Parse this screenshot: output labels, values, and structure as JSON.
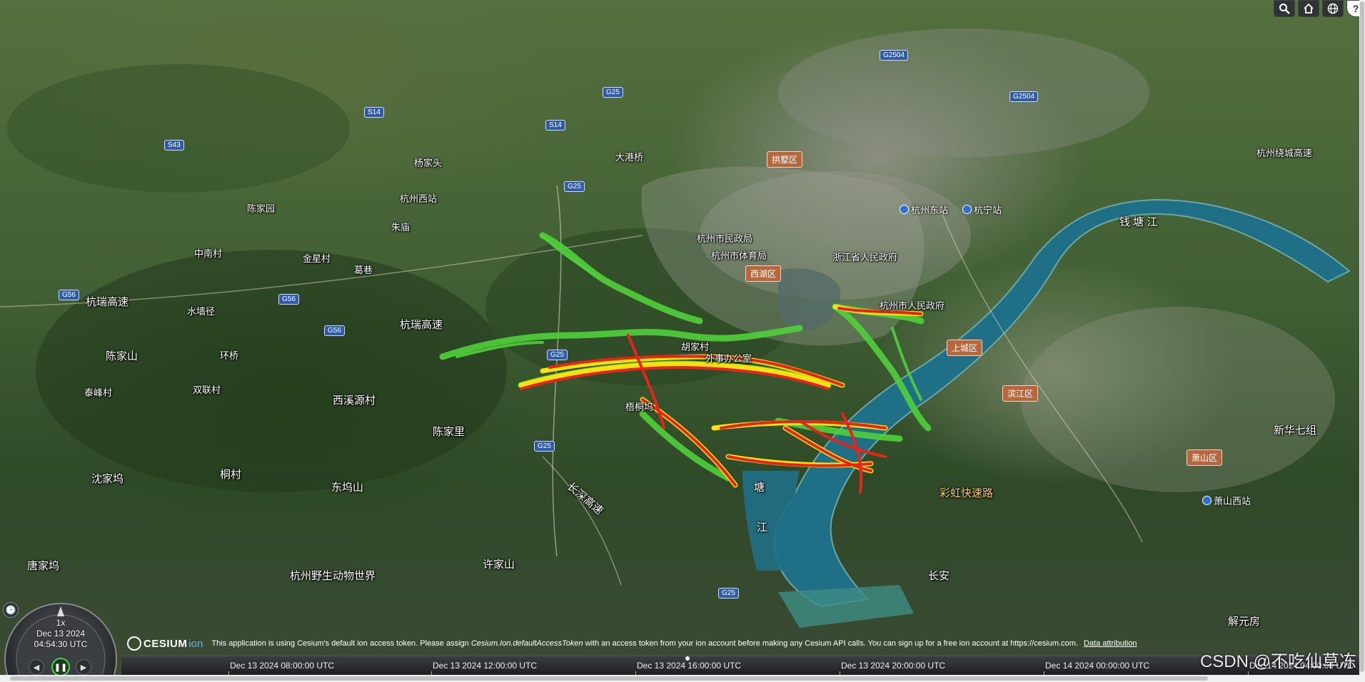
{
  "toolbar": {
    "icons": [
      "search-icon",
      "home-icon",
      "globe-icon",
      "help-icon"
    ],
    "help_label": "?"
  },
  "map": {
    "river_label_1": "钱 塘 江",
    "river_label_2": "钱",
    "river_label_3": "塘",
    "river_label_4": "江",
    "places": [
      {
        "text": "中南村"
      },
      {
        "text": "金星村"
      },
      {
        "text": "葛巷"
      },
      {
        "text": "水墙径"
      },
      {
        "text": "杭瑞高速"
      },
      {
        "text": "杭瑞高速"
      },
      {
        "text": "陈家山"
      },
      {
        "text": "环桥"
      },
      {
        "text": "双联村"
      },
      {
        "text": "泰峰村"
      },
      {
        "text": "西溪源村"
      },
      {
        "text": "陈家里"
      },
      {
        "text": "沈家坞"
      },
      {
        "text": "桐村"
      },
      {
        "text": "东坞山"
      },
      {
        "text": "唐家坞"
      },
      {
        "text": "许家山"
      },
      {
        "text": "长安"
      },
      {
        "text": "解元房"
      },
      {
        "text": "新华七组"
      },
      {
        "text": "杭州野生动物世界"
      },
      {
        "text": "彩虹快速路"
      },
      {
        "text": "长深高速"
      },
      {
        "text": "杭州市体育局"
      },
      {
        "text": "杭州市民政局"
      },
      {
        "text": "杭州市人民政府"
      },
      {
        "text": "浙江省人民政府"
      },
      {
        "text": "杭州绕城高速"
      },
      {
        "text": "陈家园"
      },
      {
        "text": "朱庙"
      },
      {
        "text": "大港桥"
      },
      {
        "text": "梧桐坞"
      },
      {
        "text": "胡家村"
      },
      {
        "text": "外事办公室"
      },
      {
        "text": "杭州西站"
      },
      {
        "text": "杨家头"
      },
      {
        "text": "西湖区"
      }
    ],
    "districts": [
      {
        "text": "拱墅区"
      },
      {
        "text": "西湖区"
      },
      {
        "text": "上城区"
      },
      {
        "text": "滨江区"
      },
      {
        "text": "萧山区"
      }
    ],
    "shields": [
      {
        "text": "G25"
      },
      {
        "text": "G25"
      },
      {
        "text": "G25"
      },
      {
        "text": "G25"
      },
      {
        "text": "G56"
      },
      {
        "text": "G56"
      },
      {
        "text": "G56"
      },
      {
        "text": "S14"
      },
      {
        "text": "S14"
      },
      {
        "text": "S43"
      },
      {
        "text": "G2504"
      },
      {
        "text": "G2504"
      },
      {
        "text": "G25"
      }
    ],
    "pois": [
      {
        "text": "杭州东站"
      },
      {
        "text": "杭州西站"
      },
      {
        "text": "萧山西站"
      },
      {
        "text": "杭宁站"
      }
    ]
  },
  "animation": {
    "speed": "1x",
    "date": "Dec 13 2024",
    "time": "04:54:30 UTC"
  },
  "credits": {
    "brand": "CESIUM",
    "brand_suffix": "ion",
    "text_1": "This application is using Cesium's default ion access token. Please assign ",
    "text_italic": "Cesium.Ion.defaultAccessToken",
    "text_2": " with an access token from your ion account before making any Cesium API calls. You can sign up for a free ion account at  https://cesium.com.",
    "link": "Data attribution"
  },
  "timeline": {
    "ticks": [
      "Dec 13 2024 08:00:00 UTC",
      "Dec 13 2024 12:00:00 UTC",
      "Dec 13 2024 16:00:00 UTC",
      "Dec 13 2024 20:00:00 UTC",
      "Dec 14 2024 00:00:00 UTC",
      "Dec 14 2024 04:00:00 UTC"
    ]
  },
  "watermark": "CSDN @不吃仙草冻",
  "colors": {
    "river": "#1f6f86",
    "heat_hot": "#e3261a",
    "heat_mid": "#f5e20f",
    "heat_low": "#4fd03a"
  }
}
